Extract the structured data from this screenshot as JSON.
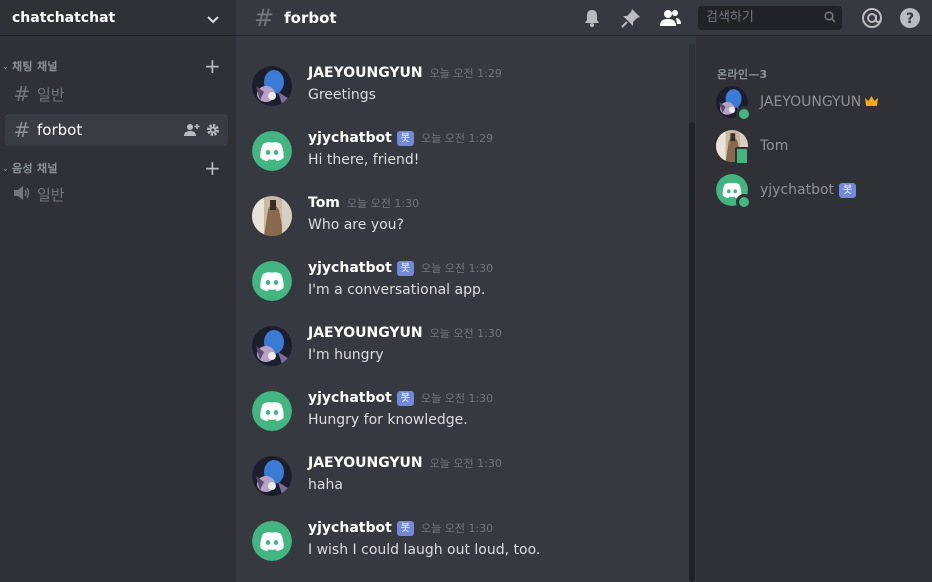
{
  "server": {
    "name": "chatchatchat"
  },
  "categories": {
    "text": {
      "label": "채팅 채널"
    },
    "voice": {
      "label": "음성 채널"
    }
  },
  "channels": {
    "text": [
      {
        "name": "일반",
        "active": false
      },
      {
        "name": "forbot",
        "active": true
      }
    ],
    "voice": [
      {
        "name": "일반"
      }
    ]
  },
  "header": {
    "channel_name": "forbot",
    "search_placeholder": "검색하기"
  },
  "messages": [
    {
      "author": "JAEYOUNGYUN",
      "bot": false,
      "time": "오늘 오전 1:29",
      "text": "Greetings",
      "avatar": "user"
    },
    {
      "author": "yjychatbot",
      "bot": true,
      "time": "오늘 오전 1:29",
      "text": "Hi there, friend!",
      "avatar": "bot"
    },
    {
      "author": "Tom",
      "bot": false,
      "time": "오늘 오전 1:30",
      "text": "Who are you?",
      "avatar": "tom"
    },
    {
      "author": "yjychatbot",
      "bot": true,
      "time": "오늘 오전 1:30",
      "text": "I'm a conversational app.",
      "avatar": "bot"
    },
    {
      "author": "JAEYOUNGYUN",
      "bot": false,
      "time": "오늘 오전 1:30",
      "text": "I'm hungry",
      "avatar": "user"
    },
    {
      "author": "yjychatbot",
      "bot": true,
      "time": "오늘 오전 1:30",
      "text": "Hungry for knowledge.",
      "avatar": "bot"
    },
    {
      "author": "JAEYOUNGYUN",
      "bot": false,
      "time": "오늘 오전 1:30",
      "text": "haha",
      "avatar": "user"
    },
    {
      "author": "yjychatbot",
      "bot": true,
      "time": "오늘 오전 1:30",
      "text": "I wish I could laugh out loud, too.",
      "avatar": "bot"
    }
  ],
  "bot_tag": "봇",
  "members": {
    "heading": "온라인—3",
    "list": [
      {
        "name": "JAEYOUNGYUN",
        "owner": true,
        "status": "online",
        "avatar": "user"
      },
      {
        "name": "Tom",
        "owner": false,
        "status": "mobile",
        "avatar": "tom"
      },
      {
        "name": "yjychatbot",
        "bot": true,
        "status": "online",
        "avatar": "bot"
      }
    ]
  },
  "colors": {
    "accent": "#7289da",
    "online": "#43b581",
    "bot_avatar": "#43b581",
    "crown": "#faa61a"
  },
  "icons": [
    "chevron-down-icon",
    "hash-icon",
    "plus-icon",
    "add-member-icon",
    "gear-icon",
    "speaker-icon",
    "bell-icon",
    "pin-icon",
    "members-icon",
    "search-icon",
    "mention-icon",
    "help-icon",
    "discord-logo-icon",
    "crown-icon"
  ]
}
